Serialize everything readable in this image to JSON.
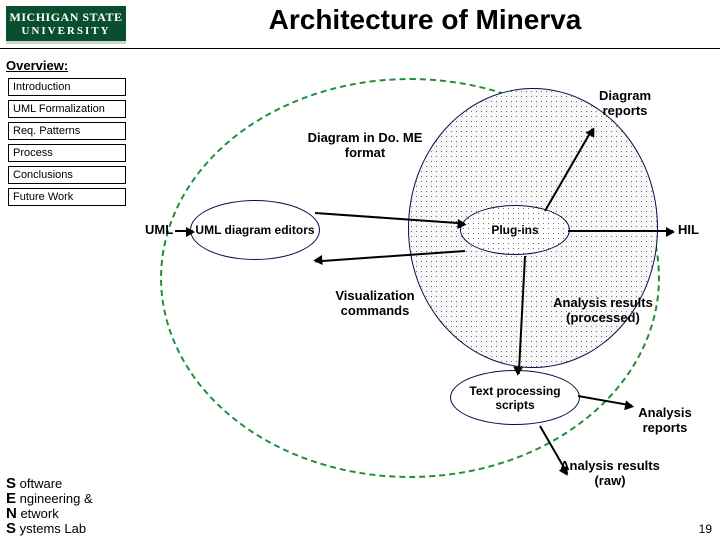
{
  "header": {
    "logo_line1": "MICHIGAN STATE",
    "logo_line2": "UNIVERSITY",
    "title": "Architecture of Minerva"
  },
  "overview_label": "Overview:",
  "nav": {
    "items": [
      {
        "label": "Introduction"
      },
      {
        "label": "UML Formalization"
      },
      {
        "label": "Req. Patterns"
      },
      {
        "label": "Process"
      },
      {
        "label": "Conclusions"
      },
      {
        "label": "Future Work"
      }
    ]
  },
  "diagram": {
    "labels": {
      "uml": "UML",
      "dome": "Diagram in Do. ME format",
      "reports": "Diagram reports",
      "hil": "HIL",
      "viz": "Visualization commands",
      "procres": "Analysis results (processed)",
      "anrep": "Analysis reports",
      "rawres": "Analysis results (raw)"
    },
    "nodes": {
      "uml_editors": "UML diagram editors",
      "plugins": "Plug-ins",
      "textproc": "Text processing scripts"
    }
  },
  "footer": {
    "sens_s": "S",
    "sens_oftware": " oftware",
    "sens_e": "E",
    "sens_ng": " ngineering &",
    "sens_n": "N",
    "sens_etwork": " etwork",
    "sens_s2": "S",
    "sens_lab": " ystems Lab",
    "page": "19"
  }
}
